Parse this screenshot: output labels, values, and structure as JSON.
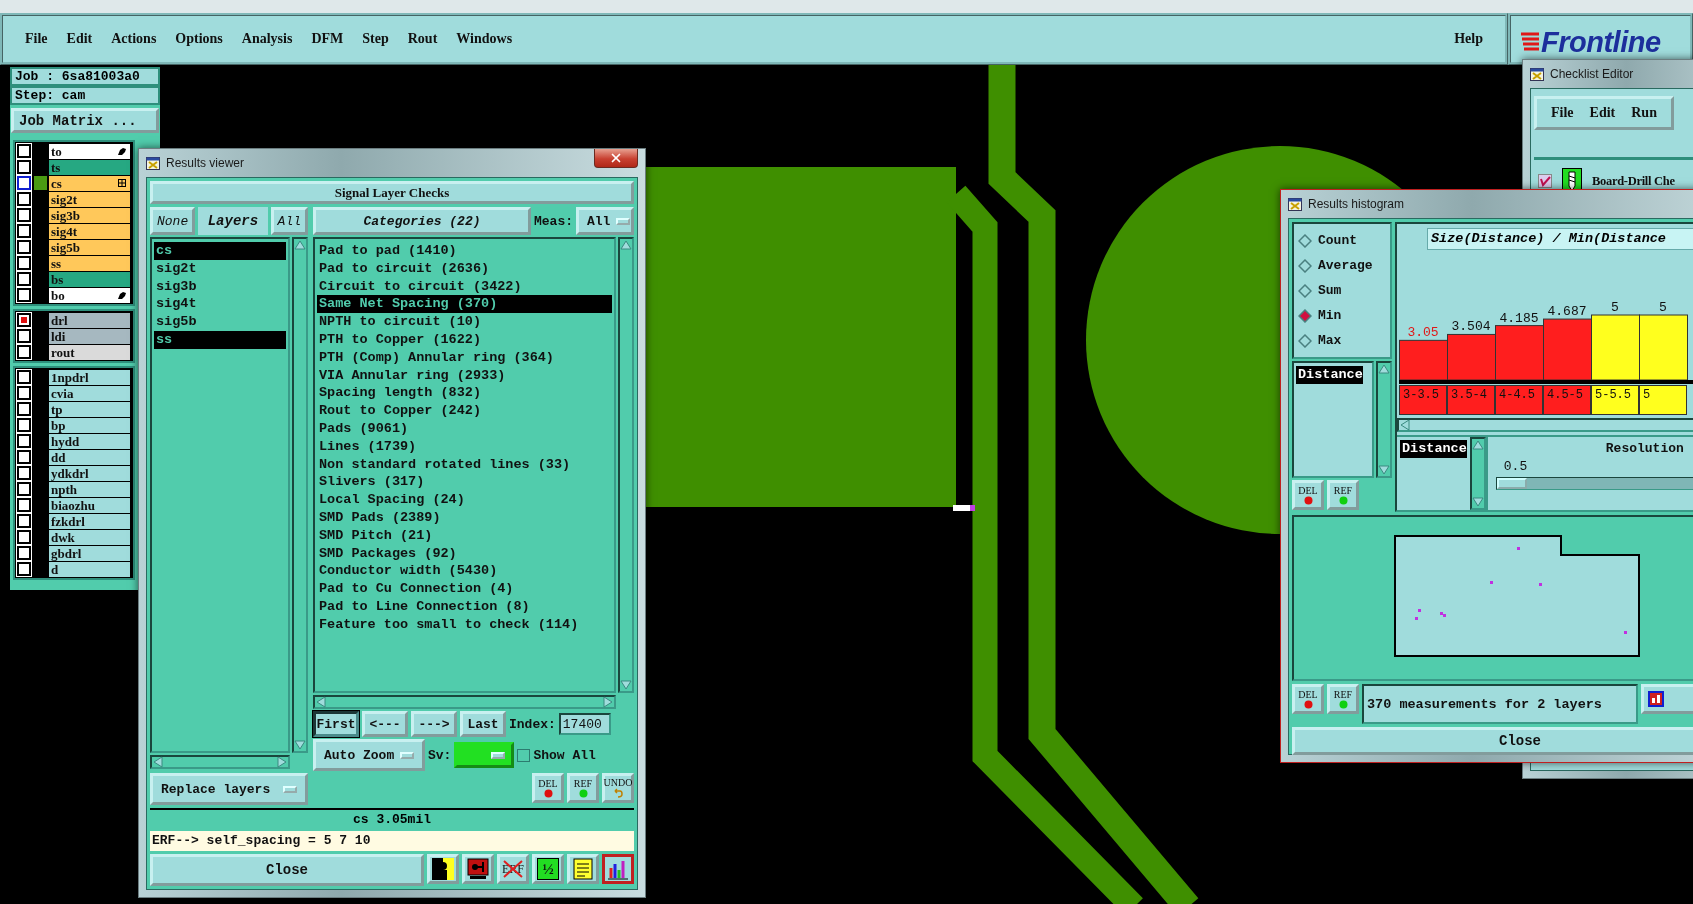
{
  "menu": [
    {
      "label": "File"
    },
    {
      "label": "Edit"
    },
    {
      "label": "Actions"
    },
    {
      "label": "Options"
    },
    {
      "label": "Analysis"
    },
    {
      "label": "DFM"
    },
    {
      "label": "Step"
    },
    {
      "label": "Rout"
    },
    {
      "label": "Windows"
    }
  ],
  "help": "Help",
  "logo": "Frontline",
  "job_panel": {
    "job": "Job : 6sa81003a0",
    "step": "Step: cam",
    "matrix_button": "Job Matrix ...",
    "layer_groups": [
      {
        "layers": [
          {
            "name": "to",
            "color": "#ffffff",
            "checked": false,
            "active": false,
            "kind": "hand"
          },
          {
            "name": "ts",
            "color": "#26a882",
            "checked": false,
            "active": false,
            "kind": "plain"
          },
          {
            "name": "cs",
            "color": "#ffc85a",
            "checked": false,
            "active": true,
            "kind": "grid"
          },
          {
            "name": "sig2t",
            "color": "#ffc85a",
            "checked": false,
            "active": false,
            "kind": "plain"
          },
          {
            "name": "sig3b",
            "color": "#ffc85a",
            "checked": false,
            "active": false,
            "kind": "plain"
          },
          {
            "name": "sig4t",
            "color": "#ffc85a",
            "checked": false,
            "active": false,
            "kind": "plain"
          },
          {
            "name": "sig5b",
            "color": "#ffc85a",
            "checked": false,
            "active": false,
            "kind": "plain"
          },
          {
            "name": "ss",
            "color": "#ffc85a",
            "checked": false,
            "active": false,
            "kind": "plain"
          },
          {
            "name": "bs",
            "color": "#26a882",
            "checked": false,
            "active": false,
            "kind": "plain"
          },
          {
            "name": "bo",
            "color": "#ffffff",
            "checked": false,
            "active": false,
            "kind": "hand"
          }
        ]
      },
      {
        "layers": [
          {
            "name": "drl",
            "color": "#a6b8c0",
            "checked": true,
            "active": false,
            "kind": "plain"
          },
          {
            "name": "ldi",
            "color": "#a6b8c0",
            "checked": false,
            "active": false,
            "kind": "plain"
          },
          {
            "name": "rout",
            "color": "#dadada",
            "checked": false,
            "active": false,
            "kind": "plain"
          }
        ]
      },
      {
        "layers": [
          {
            "name": "1npdrl",
            "color": "#a0dcdc",
            "checked": false,
            "active": false,
            "kind": "plain"
          },
          {
            "name": "cvia",
            "color": "#a0dcdc",
            "checked": false,
            "active": false,
            "kind": "plain"
          },
          {
            "name": "tp",
            "color": "#a0dcdc",
            "checked": false,
            "active": false,
            "kind": "plain"
          },
          {
            "name": "bp",
            "color": "#a0dcdc",
            "checked": false,
            "active": false,
            "kind": "plain"
          },
          {
            "name": "hydd",
            "color": "#a0dcdc",
            "checked": false,
            "active": false,
            "kind": "plain"
          },
          {
            "name": "dd",
            "color": "#a0dcdc",
            "checked": false,
            "active": false,
            "kind": "plain"
          },
          {
            "name": "ydkdrl",
            "color": "#a0dcdc",
            "checked": false,
            "active": false,
            "kind": "plain"
          },
          {
            "name": "npth",
            "color": "#a0dcdc",
            "checked": false,
            "active": false,
            "kind": "plain"
          },
          {
            "name": "biaozhu",
            "color": "#a0dcdc",
            "checked": false,
            "active": false,
            "kind": "plain"
          },
          {
            "name": "fzkdrl",
            "color": "#a0dcdc",
            "checked": false,
            "active": false,
            "kind": "plain"
          },
          {
            "name": "dwk",
            "color": "#a0dcdc",
            "checked": false,
            "active": false,
            "kind": "plain"
          },
          {
            "name": "gbdrl",
            "color": "#a0dcdc",
            "checked": false,
            "active": false,
            "kind": "plain"
          },
          {
            "name": "d",
            "color": "#a0dcdc",
            "checked": false,
            "active": false,
            "kind": "plain"
          }
        ]
      }
    ]
  },
  "results_viewer": {
    "title": "Results viewer",
    "header": "Signal Layer Checks",
    "none_button": "None",
    "layers_label": "Layers",
    "all_button": "All",
    "layers": [
      {
        "name": "cs",
        "selected": true
      },
      {
        "name": "sig2t",
        "selected": false
      },
      {
        "name": "sig3b",
        "selected": false
      },
      {
        "name": "sig4t",
        "selected": false
      },
      {
        "name": "sig5b",
        "selected": false
      },
      {
        "name": "ss",
        "selected": true
      }
    ],
    "replace_dropdown": "Replace layers",
    "categories_button": "Categories (22)",
    "meas_label": "Meas:",
    "meas_value": "All",
    "categories": [
      {
        "label": "Pad to pad (1410)",
        "selected": false
      },
      {
        "label": "Pad to circuit (2636)",
        "selected": false
      },
      {
        "label": "Circuit to circuit (3422)",
        "selected": false
      },
      {
        "label": "Same Net Spacing (370)",
        "selected": true
      },
      {
        "label": "NPTH to circuit (10)",
        "selected": false
      },
      {
        "label": "PTH to Copper (1622)",
        "selected": false
      },
      {
        "label": "PTH (Comp) Annular ring (364)",
        "selected": false
      },
      {
        "label": "VIA Annular ring (2933)",
        "selected": false
      },
      {
        "label": "Spacing length (832)",
        "selected": false
      },
      {
        "label": "Rout to Copper (242)",
        "selected": false
      },
      {
        "label": "Pads (9061)",
        "selected": false
      },
      {
        "label": "Lines (1739)",
        "selected": false
      },
      {
        "label": "Non standard rotated lines (33)",
        "selected": false
      },
      {
        "label": "Slivers (317)",
        "selected": false
      },
      {
        "label": "Local Spacing (24)",
        "selected": false
      },
      {
        "label": "SMD Pads (2389)",
        "selected": false
      },
      {
        "label": "SMD Pitch (21)",
        "selected": false
      },
      {
        "label": "SMD Packages (92)",
        "selected": false
      },
      {
        "label": "Conductor width (5430)",
        "selected": false
      },
      {
        "label": "Pad to Cu Connection (4)",
        "selected": false
      },
      {
        "label": "Pad to Line Connection (8)",
        "selected": false
      },
      {
        "label": "Feature too small to check (114)",
        "selected": false
      }
    ],
    "nav_buttons": [
      {
        "label": "First",
        "selected": true
      },
      {
        "label": "<---",
        "selected": false
      },
      {
        "label": "--->",
        "selected": false
      },
      {
        "label": "Last",
        "selected": false
      }
    ],
    "index_label": "Index:",
    "index_value": "17400",
    "zoom_dropdown": "Auto Zoom",
    "sv_label": "Sv:",
    "show_all": {
      "label": "Show All",
      "checked": false
    },
    "edit_buttons": [
      {
        "kind": "del",
        "label": "DEL"
      },
      {
        "kind": "ref",
        "label": "REF"
      },
      {
        "kind": "undo",
        "label": "UNDO"
      }
    ],
    "status": "cs 3.05mil",
    "erf_line": "ERF--> self_spacing = 5 7 10",
    "close": "Close",
    "tool_icons": [
      {
        "kind": "figure",
        "selected": false
      },
      {
        "kind": "monitor",
        "selected": false
      },
      {
        "kind": "erf",
        "label": "ERF",
        "selected": false
      },
      {
        "kind": "page",
        "label": "½",
        "selected": false
      },
      {
        "kind": "notes",
        "selected": false
      },
      {
        "kind": "chart",
        "selected": true
      }
    ]
  },
  "histogram": {
    "title": "Results histogram",
    "modes": [
      {
        "label": "Count",
        "selected": false
      },
      {
        "label": "Average",
        "selected": false
      },
      {
        "label": "Sum",
        "selected": false
      },
      {
        "label": "Min",
        "selected": true
      },
      {
        "label": "Max",
        "selected": false
      }
    ],
    "measure_list": [
      {
        "label": "Distance",
        "selected": true
      }
    ],
    "list_buttons": [
      {
        "kind": "del",
        "label": "DEL"
      },
      {
        "kind": "ref",
        "label": "REF"
      }
    ],
    "chart_title": "Size(Distance) / Min(Distance",
    "chart_data": {
      "type": "bar",
      "categories": [
        "3-3.5",
        "3.5-4",
        "4-4.5",
        "4.5-5",
        "5-5.5",
        "5"
      ],
      "values": [
        3.05,
        3.504,
        4.185,
        4.687,
        5,
        5
      ],
      "data_labels": true
    },
    "bins": [
      {
        "color": "#ff1e1e",
        "current": true
      },
      {
        "color": "#ff1e1e",
        "current": false
      },
      {
        "color": "#ff1e1e",
        "current": false
      },
      {
        "color": "#ff1e1e",
        "current": false
      },
      {
        "color": "#ffff1e",
        "current": false
      },
      {
        "color": "#ffff1e",
        "current": false
      }
    ],
    "bottom_list": [
      {
        "label": "Distance",
        "selected": true
      }
    ],
    "resolution": {
      "label": "Resolution",
      "value": "0.5",
      "level": 0
    },
    "footer_buttons": [
      {
        "kind": "del",
        "label": "DEL"
      },
      {
        "kind": "ref",
        "label": "REF"
      }
    ],
    "summary": "370 measurements for 2 layers",
    "close": "Close"
  },
  "checklist_editor": {
    "title": "Checklist Editor",
    "menu": [
      {
        "label": "File"
      },
      {
        "label": "Edit"
      },
      {
        "label": "Run"
      }
    ],
    "checks": [
      {
        "label": "Board-Drill Che",
        "checked": true
      }
    ]
  }
}
